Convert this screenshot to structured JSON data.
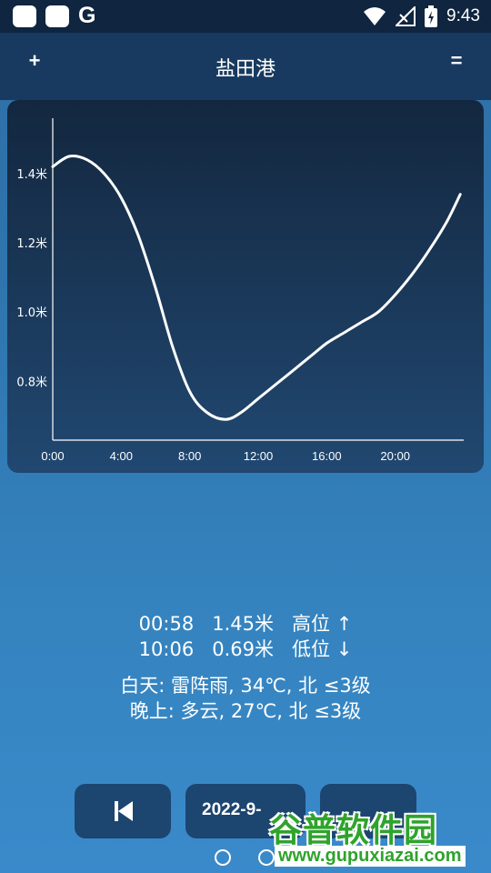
{
  "status_bar": {
    "time": "9:43",
    "icons": [
      "app-icon",
      "app-icon",
      "google-icon",
      "wifi-icon",
      "signal-icon",
      "battery-icon"
    ],
    "google_letter": "G"
  },
  "header": {
    "title": "盐田港",
    "add_label": "+",
    "menu_label": "="
  },
  "chart_data": {
    "type": "line",
    "title": "",
    "xlabel": "",
    "ylabel": "",
    "x_ticks": [
      "0:00",
      "4:00",
      "8:00",
      "12:00",
      "16:00",
      "20:00"
    ],
    "y_ticks": [
      "0.8米",
      "1.0米",
      "1.2米",
      "1.4米"
    ],
    "y_tick_values": [
      0.8,
      1.0,
      1.2,
      1.4
    ],
    "xlim": [
      0,
      24
    ],
    "ylim": [
      0.63,
      1.56
    ],
    "x_unit": "hours",
    "series": [
      {
        "x": [
          0,
          0.97,
          2,
          3,
          4,
          5,
          6,
          7,
          8,
          9,
          10.1,
          11,
          12,
          13,
          14,
          15,
          16,
          17,
          18,
          19,
          20,
          21,
          22,
          23,
          23.8
        ],
        "y": [
          1.42,
          1.45,
          1.44,
          1.4,
          1.33,
          1.22,
          1.07,
          0.9,
          0.77,
          0.71,
          0.69,
          0.71,
          0.75,
          0.79,
          0.83,
          0.87,
          0.91,
          0.94,
          0.97,
          1.0,
          1.05,
          1.11,
          1.18,
          1.26,
          1.34
        ]
      }
    ],
    "grid": false,
    "line_color": "#ffffff"
  },
  "tide_info": {
    "rows": [
      {
        "time": "00:58",
        "height": "1.45米",
        "type": "高位",
        "arrow": "↑"
      },
      {
        "time": "10:06",
        "height": "0.69米",
        "type": "低位",
        "arrow": "↓"
      }
    ]
  },
  "weather": {
    "day": "白天: 雷阵雨, 34℃, 北 ≤3级",
    "night": "晚上: 多云, 27℃, 北 ≤3级"
  },
  "controls": {
    "date_label": "2022-9-"
  },
  "watermark": {
    "name": "谷普软件园",
    "url": "www.gupuxiazai.com"
  },
  "colors": {
    "header": "#183a60",
    "status_bar": "#0f2540",
    "button": "#1c4570",
    "watermark": "#2fa32c"
  }
}
